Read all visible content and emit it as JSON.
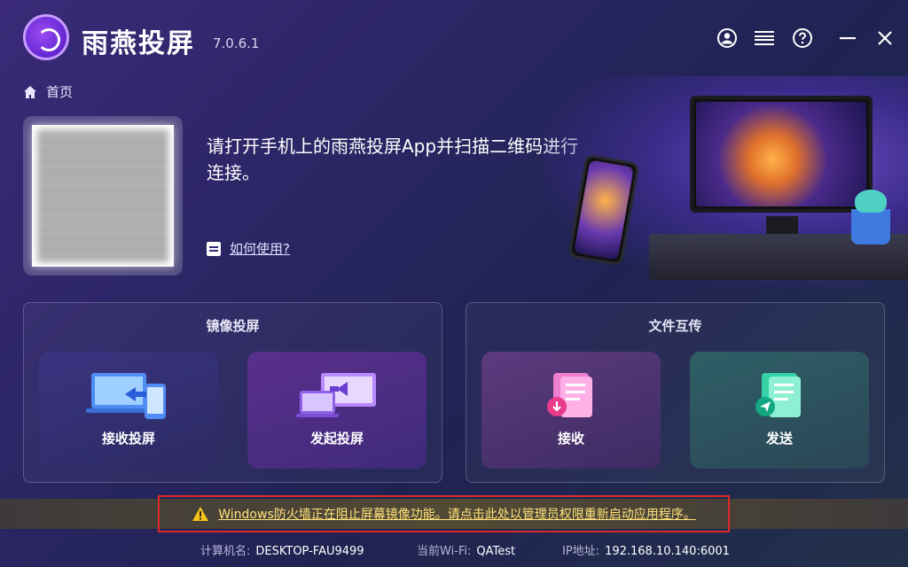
{
  "app": {
    "title": "雨燕投屏",
    "version": "7.0.6.1"
  },
  "window_controls": {
    "icons": [
      "user-icon",
      "menu-icon",
      "help-icon",
      "minimize-icon",
      "close-icon"
    ]
  },
  "breadcrumb": {
    "label": "首页"
  },
  "connect": {
    "instruction": "请打开手机上的雨燕投屏App并扫描二维码进行连接。",
    "howto_label": "如何使用?"
  },
  "mirror_panel": {
    "title": "镜像投屏",
    "tiles": [
      {
        "label": "接收投屏",
        "icon": "receive-mirror-icon"
      },
      {
        "label": "发起投屏",
        "icon": "start-mirror-icon"
      }
    ]
  },
  "file_panel": {
    "title": "文件互传",
    "tiles": [
      {
        "label": "接收",
        "icon": "receive-file-icon"
      },
      {
        "label": "发送",
        "icon": "send-file-icon"
      }
    ]
  },
  "warning": {
    "text": "Windows防火墙正在阻止屏幕镜像功能。请点击此处以管理员权限重新启动应用程序。",
    "accent": "#ffe27a",
    "frame_color": "#e02828"
  },
  "status": {
    "computer_label": "计算机名:",
    "computer_value": "DESKTOP-FAU9499",
    "wifi_label": "当前Wi-Fi:",
    "wifi_value": "QATest",
    "ip_label": "IP地址:",
    "ip_value": "192.168.10.140:6001"
  }
}
